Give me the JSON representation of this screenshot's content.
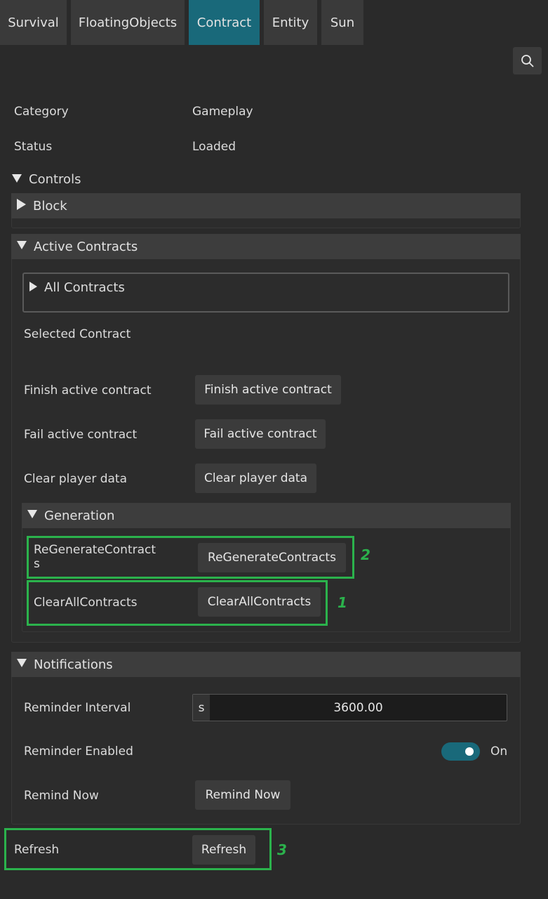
{
  "tabs": [
    "Survival",
    "FloatingObjects",
    "Contract",
    "Entity",
    "Sun"
  ],
  "active_tab": "Contract",
  "colors": {
    "accent": "#19697a",
    "highlight": "#2bb24c",
    "background": "#2a2a2a"
  },
  "info": {
    "category_label": "Category",
    "category_value": "Gameplay",
    "status_label": "Status",
    "status_value": "Loaded"
  },
  "controls": {
    "title": "Controls",
    "block_title": "Block",
    "active_contracts": {
      "title": "Active Contracts",
      "all_contracts": "All Contracts",
      "selected_contract_label": "Selected Contract",
      "finish_label": "Finish active contract",
      "finish_button": "Finish active contract",
      "fail_label": "Fail active contract",
      "fail_button": "Fail active contract",
      "clear_label": "Clear player data",
      "clear_button": "Clear player data",
      "generation": {
        "title": "Generation",
        "regen_label_line1": "ReGenerateContract",
        "regen_label_line2": "s",
        "regen_button": "ReGenerateContracts",
        "clearall_label": "ClearAllContracts",
        "clearall_button": "ClearAllContracts"
      }
    },
    "notifications": {
      "title": "Notifications",
      "interval_label": "Reminder Interval",
      "interval_unit": "s",
      "interval_value": "3600.00",
      "enabled_label": "Reminder Enabled",
      "enabled_state": "On",
      "enabled": true,
      "remind_label": "Remind Now",
      "remind_button": "Remind Now"
    }
  },
  "refresh": {
    "label": "Refresh",
    "button": "Refresh"
  },
  "annotations": [
    "2",
    "1",
    "3"
  ],
  "icons": {
    "search": "search-icon",
    "collapse": "triangle-down-icon",
    "expand": "triangle-right-icon"
  }
}
